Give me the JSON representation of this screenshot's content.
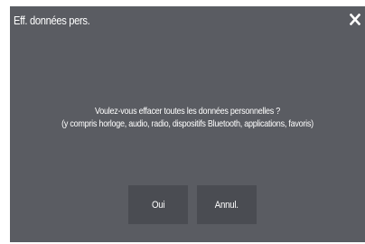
{
  "dialog": {
    "title": "Eff. données pers.",
    "close_icon": "close-icon",
    "message_line1": "Voulez-vous effacer toutes les données personnelles ?",
    "message_line2": "(y compris horloge, audio, radio, dispositifs Bluetooth, applications, favoris)",
    "yes_label": "Oui",
    "cancel_label": "Annul."
  },
  "colors": {
    "dialog_background": "#5a5c62",
    "button_background": "#4a4c52",
    "text": "#ffffff"
  }
}
